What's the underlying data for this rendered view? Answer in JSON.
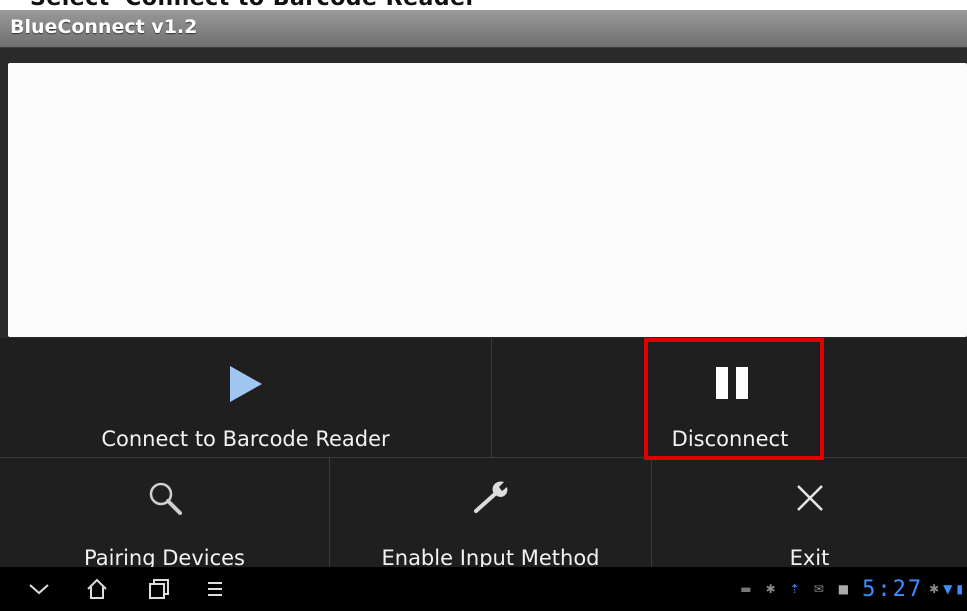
{
  "top_overlay_text": "Select 'Connect to Barcode Reader'",
  "app": {
    "title": "BlueConnect v1.2"
  },
  "menu": {
    "items": [
      {
        "label": "Connect to Barcode Reader",
        "icon": "play-icon"
      },
      {
        "label": "Disconnect",
        "icon": "pause-icon"
      },
      {
        "label": "Pairing Devices",
        "icon": "search-icon"
      },
      {
        "label": "Enable Input Method",
        "icon": "wrench-icon"
      },
      {
        "label": "Exit",
        "icon": "close-icon"
      }
    ]
  },
  "nav": {
    "buttons": [
      "chevron-down-icon",
      "home-icon",
      "recent-apps-icon",
      "menu-icon"
    ]
  },
  "status": {
    "time": "5:27",
    "icons": [
      "usb-icon",
      "bluetooth-icon",
      "upload-icon",
      "mail-icon",
      "lock-icon",
      "bluetooth-icon",
      "signal-icon",
      "battery-icon"
    ]
  },
  "colors": {
    "title_bar": "#7f7f7f",
    "menu_bg": "#1f1f1f",
    "highlight": "#e00000",
    "status_accent": "#3d8fff"
  }
}
